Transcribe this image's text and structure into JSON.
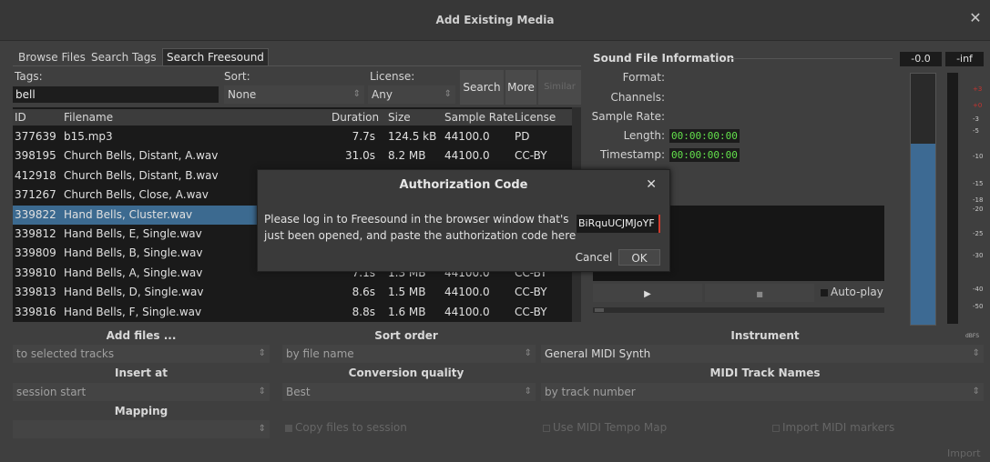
{
  "window": {
    "title": "Add Existing Media",
    "close": "✕"
  },
  "tabs": [
    "Browse Files",
    "Search Tags",
    "Search Freesound"
  ],
  "search": {
    "tags_label": "Tags:",
    "tags_value": "bell",
    "sort_label": "Sort:",
    "sort_value": "None",
    "license_label": "License:",
    "license_value": "Any",
    "search_btn": "Search",
    "more_btn": "More",
    "similar_btn": "Similar"
  },
  "table": {
    "headers": [
      "ID",
      "Filename",
      "Duration",
      "Size",
      "Sample Rate",
      "License"
    ],
    "rows": [
      {
        "id": "377639",
        "name": "b15.mp3",
        "dur": "7.7s",
        "size": "124.5 kB",
        "rate": "44100.0",
        "lic": "PD"
      },
      {
        "id": "398195",
        "name": "Church Bells, Distant, A.wav",
        "dur": "31.0s",
        "size": "8.2 MB",
        "rate": "44100.0",
        "lic": "CC-BY"
      },
      {
        "id": "412918",
        "name": "Church Bells, Distant, B.wav",
        "dur": "",
        "size": "",
        "rate": "",
        "lic": ""
      },
      {
        "id": "371267",
        "name": "Church Bells, Close, A.wav",
        "dur": "",
        "size": "",
        "rate": "",
        "lic": ""
      },
      {
        "id": "339822",
        "name": "Hand Bells, Cluster.wav",
        "dur": "",
        "size": "",
        "rate": "",
        "lic": ""
      },
      {
        "id": "339812",
        "name": "Hand Bells, E, Single.wav",
        "dur": "",
        "size": "",
        "rate": "",
        "lic": ""
      },
      {
        "id": "339809",
        "name": "Hand Bells, B, Single.wav",
        "dur": "",
        "size": "",
        "rate": "",
        "lic": ""
      },
      {
        "id": "339810",
        "name": "Hand Bells, A, Single.wav",
        "dur": "7.1s",
        "size": "1.3 MB",
        "rate": "44100.0",
        "lic": "CC-BY"
      },
      {
        "id": "339813",
        "name": "Hand Bells, D, Single.wav",
        "dur": "8.6s",
        "size": "1.5 MB",
        "rate": "44100.0",
        "lic": "CC-BY"
      },
      {
        "id": "339816",
        "name": "Hand Bells, F, Single.wav",
        "dur": "8.8s",
        "size": "1.6 MB",
        "rate": "44100.0",
        "lic": "CC-BY"
      }
    ],
    "selected_index": 4
  },
  "info": {
    "title": "Sound File Information",
    "format_label": "Format:",
    "channels_label": "Channels:",
    "samplerate_label": "Sample Rate:",
    "length_label": "Length:",
    "length_value": "00:00:00:00",
    "timestamp_label": "Timestamp:",
    "timestamp_value": "00:00:00:00",
    "play_icon": "▶",
    "stop_icon": "■",
    "autoplay_label": "Auto-play"
  },
  "meter": {
    "peak_left": "-0.0",
    "peak_right": "-inf",
    "scale": [
      "+3",
      "+0",
      "-3",
      "-5",
      "-10",
      "-15",
      "-18",
      "-20",
      "-25",
      "-30",
      "-40",
      "-50"
    ],
    "unit": "dBFS",
    "level_fraction": 0.72
  },
  "dialog": {
    "title": "Authorization Code",
    "close": "✕",
    "message_line1": "Please log in to Freesound in the browser window that's",
    "message_line2": "just been opened, and paste the authorization code here",
    "code_value": "BiRquUCJMJoYF",
    "cancel": "Cancel",
    "ok": "OK"
  },
  "options": {
    "add_files_label": "Add files ...",
    "add_files_value": "to selected tracks",
    "sort_order_label": "Sort order",
    "sort_order_value": "by file name",
    "instrument_label": "Instrument",
    "instrument_value": "General MIDI Synth",
    "insert_at_label": "Insert at",
    "insert_at_value": "session start",
    "conversion_label": "Conversion quality",
    "conversion_value": "Best",
    "midi_names_label": "MIDI Track Names",
    "midi_names_value": "by track number",
    "mapping_label": "Mapping",
    "mapping_value": "",
    "copy_files": "Copy files to session",
    "use_tempo": "Use MIDI Tempo Map",
    "import_markers": "Import MIDI markers",
    "import_btn": "Import"
  }
}
